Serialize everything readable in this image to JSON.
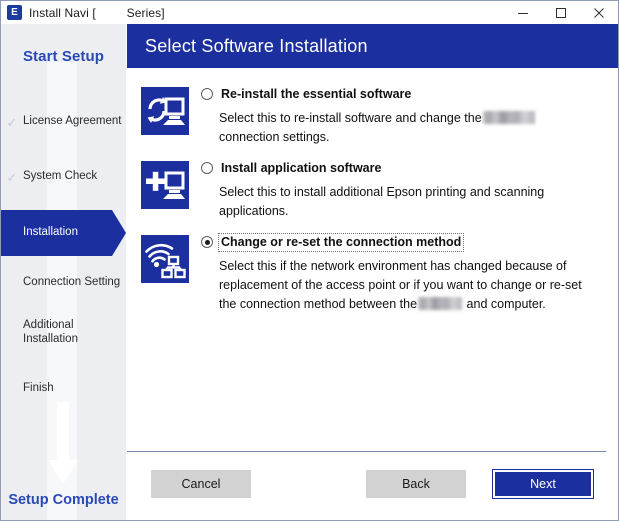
{
  "window": {
    "title": "Install Navi [         Series]",
    "app_icon": "epson-e-icon",
    "minimize_label": "Minimize",
    "maximize_label": "Maximize",
    "close_label": "Close"
  },
  "sidebar": {
    "heading": "Start Setup",
    "footer": "Setup Complete",
    "items": [
      {
        "label": "License Agreement",
        "state": "done",
        "check": "✓"
      },
      {
        "label": "System Check",
        "state": "done",
        "check": "✓"
      },
      {
        "label": "Installation",
        "state": "active",
        "check": ""
      },
      {
        "label": "Connection Setting",
        "state": "pending",
        "check": ""
      },
      {
        "label": "Additional\nInstallation",
        "state": "pending",
        "check": ""
      },
      {
        "label": "Finish",
        "state": "pending",
        "check": ""
      }
    ]
  },
  "header": {
    "title": "Select Software Installation",
    "background": "#1b2f9e"
  },
  "options": [
    {
      "icon": "reinstall-software-icon",
      "title": "Re-install the essential software",
      "selected": false,
      "focused": false,
      "desc_part1": "Select this to re-install software and change the",
      "desc_redacted": true,
      "desc_part2": "connection settings."
    },
    {
      "icon": "install-application-icon",
      "title": "Install application software",
      "selected": false,
      "focused": false,
      "desc_part1": "Select this to install additional Epson printing and scanning",
      "desc_redacted": false,
      "desc_part2": "applications."
    },
    {
      "icon": "network-connection-icon",
      "title": "Change or re-set the connection method",
      "selected": true,
      "focused": true,
      "desc_part1": "Select this if the network environment has changed because of replacement of the access point or if you want to change or re-set the connection method between the",
      "desc_redacted": true,
      "desc_part2": "and computer."
    }
  ],
  "footer": {
    "cancel_label": "Cancel",
    "back_label": "Back",
    "next_label": "Next"
  },
  "colors": {
    "brand_blue": "#1b2f9e",
    "link_blue": "#2a49b8",
    "sidebar_bg": "#eceef1",
    "button_gray": "#d2d2d2"
  }
}
